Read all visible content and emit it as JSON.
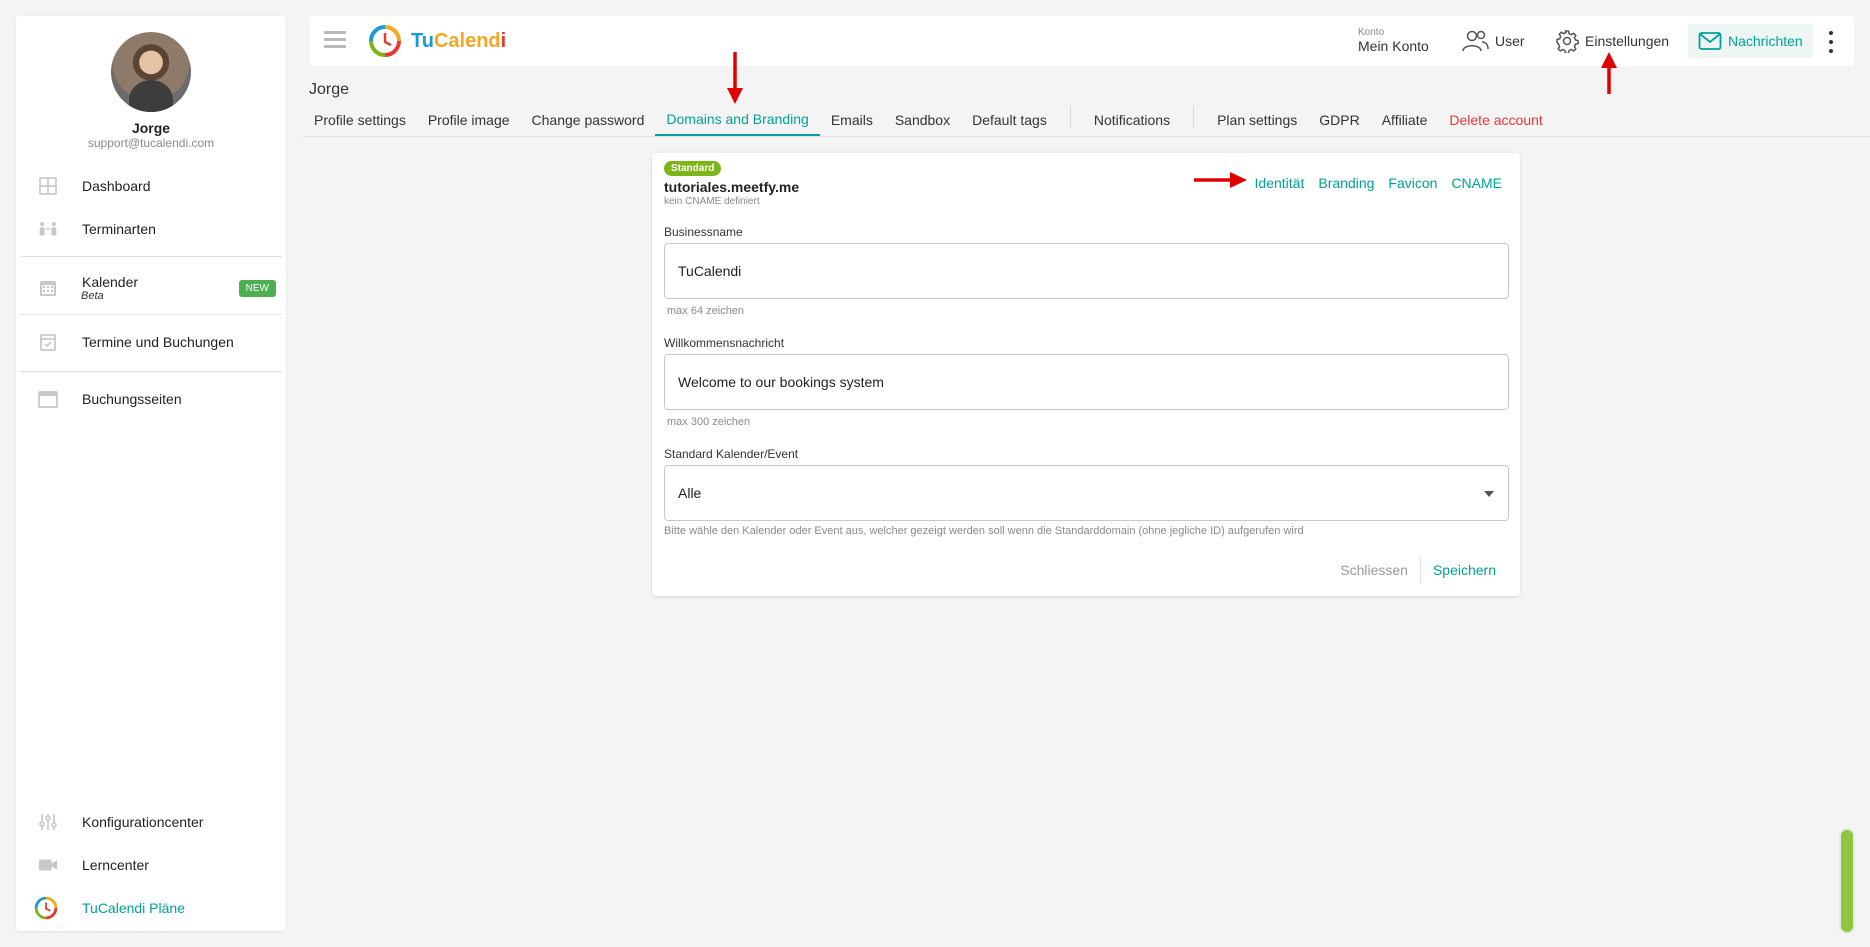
{
  "sidebar": {
    "user": {
      "name": "Jorge",
      "email": "support@tucalendi.com"
    },
    "items": [
      {
        "label": "Dashboard",
        "icon": "dashboard-icon"
      },
      {
        "label": "Terminarten",
        "icon": "people-icon"
      },
      {
        "label": "Kalender",
        "sub": "Beta",
        "badge": "NEW",
        "icon": "calendar-icon"
      },
      {
        "label": "Termine und Buchungen",
        "icon": "calendar-check-icon"
      },
      {
        "label": "Buchungsseiten",
        "icon": "window-icon"
      }
    ],
    "bottom_items": [
      {
        "label": "Konfigurationcenter",
        "icon": "sliders-icon"
      },
      {
        "label": "Lerncenter",
        "icon": "video-icon"
      },
      {
        "label": "TuCalendi Pläne",
        "icon": "tucalendi-logo-icon"
      }
    ]
  },
  "topbar": {
    "logo": {
      "tu": "Tu",
      "cal": "Calend",
      "i": "i"
    },
    "konto_label": "Konto",
    "konto_value": "Mein Konto",
    "user": "User",
    "settings": "Einstellungen",
    "messages": "Nachrichten"
  },
  "page": {
    "user": "Jorge",
    "tabs": [
      "Profile settings",
      "Profile image",
      "Change password",
      "Domains and Branding",
      "Emails",
      "Sandbox",
      "Default tags",
      "Notifications",
      "Plan settings",
      "GDPR",
      "Affiliate",
      "Delete account"
    ],
    "active_tab": "Domains and Branding"
  },
  "card": {
    "badge": "Standard",
    "domain": "tutoriales.meetfy.me",
    "domain_sub": "kein CNAME definiert",
    "links": [
      "Identität",
      "Branding",
      "Favicon",
      "CNAME"
    ],
    "business": {
      "label": "Businessname",
      "value": "TuCalendi",
      "hint": "max 64 zeichen"
    },
    "welcome": {
      "label": "Willkommensnachricht",
      "value": "Welcome to our bookings system",
      "hint": "max 300 zeichen"
    },
    "calendar": {
      "label": "Standard Kalender/Event",
      "value": "Alle",
      "hint": "Bitte wähle den Kalender oder Event aus, welcher gezeigt werden soll wenn die Standarddomain (ohne jegliche ID) aufgerufen wird"
    },
    "close": "Schliessen",
    "save": "Speichern"
  },
  "colors": {
    "accent": "#00a19a",
    "danger": "#e53935",
    "badge": "#7cb518",
    "new_badge": "#4caf50",
    "arrow": "#e10000"
  }
}
